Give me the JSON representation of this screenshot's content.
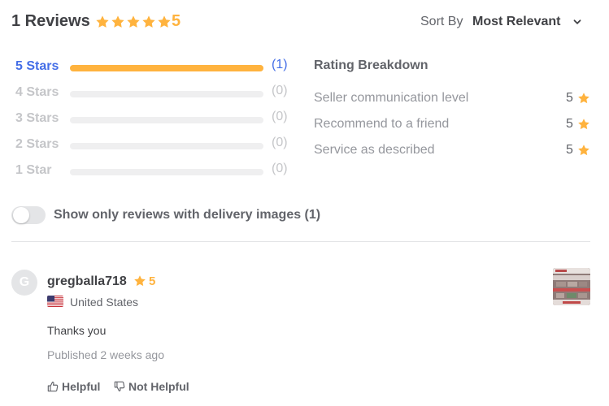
{
  "header": {
    "review_count_text": "1 Reviews",
    "average_rating": "5",
    "star_count": 5,
    "sort_label": "Sort By",
    "sort_value": "Most Relevant"
  },
  "rating_bars": [
    {
      "label": "5 Stars",
      "count": "(1)",
      "fill": 1.0
    },
    {
      "label": "4 Stars",
      "count": "(0)",
      "fill": 0
    },
    {
      "label": "3 Stars",
      "count": "(0)",
      "fill": 0
    },
    {
      "label": "2 Stars",
      "count": "(0)",
      "fill": 0
    },
    {
      "label": "1 Star",
      "count": "(0)",
      "fill": 0
    }
  ],
  "breakdown": {
    "title": "Rating Breakdown",
    "items": [
      {
        "label": "Seller communication level",
        "value": "5"
      },
      {
        "label": "Recommend to a friend",
        "value": "5"
      },
      {
        "label": "Service as described",
        "value": "5"
      }
    ]
  },
  "filter": {
    "label": "Show only reviews with delivery images (1)",
    "enabled": false
  },
  "review": {
    "avatar_letter": "G",
    "username": "gregballa718",
    "rating": "5",
    "country": "United States",
    "text": "Thanks you",
    "published": "Published 2 weeks ago",
    "helpful_label": "Helpful",
    "not_helpful_label": "Not Helpful"
  },
  "colors": {
    "star": "#ffb33e",
    "active_link": "#446ee7",
    "inactive": "#c5c6c9",
    "track": "#efeff0"
  },
  "icons": [
    "star-icon",
    "chevron-down-icon",
    "us-flag-icon",
    "thumbs-up-icon",
    "thumbs-down-icon"
  ]
}
